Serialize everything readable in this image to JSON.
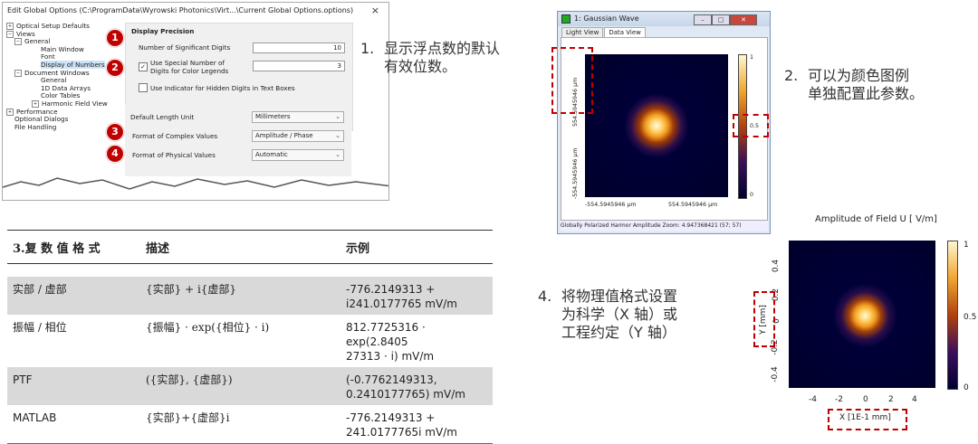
{
  "dialog": {
    "title": "Edit Global Options (C:\\ProgramData\\Wyrowski Photonics\\Virt...\\Current Global Options.options)",
    "close_glyph": "×",
    "tree": {
      "optical_setup": "Optical Setup Defaults",
      "views": "Views",
      "general": "General",
      "main_window": "Main Window",
      "font": "Font",
      "display_numbers": "Display of Numbers",
      "document_windows": "Document Windows",
      "general2": "General",
      "data_arrays": "1D Data Arrays",
      "color_tables": "Color Tables",
      "harmonic": "Harmonic Field View",
      "performance": "Performance",
      "optional_dialogs": "Optional Dialogs",
      "file_handling": "File Handling"
    },
    "section_title": "Display Precision",
    "sig_digits_label": "Number of Significant Digits",
    "sig_digits_value": "10",
    "special_label_1": "Use Special Number of",
    "special_label_2": "Digits for Color Legends",
    "special_checked": "✓",
    "special_value": "3",
    "hidden_label": "Use Indicator for Hidden Digits in Text Boxes",
    "length_label": "Default Length Unit",
    "length_value": "Millimeters",
    "complex_label": "Format of Complex Values",
    "complex_value": "Amplitude / Phase",
    "physical_label": "Format of Physical Values",
    "physical_value": "Automatic",
    "badges": [
      "1",
      "2",
      "3",
      "4"
    ]
  },
  "notes": {
    "n1_num": "1.",
    "n1_line1": "显示浮点数的默认",
    "n1_line2": "有效位数。",
    "n2_num": "2.",
    "n2_line1": "可以为颜色图例",
    "n2_line2": "单独配置此参数。",
    "n4_num": "4.",
    "n4_line1": "将物理值格式设置",
    "n4_line2": "为科学（X 轴）或",
    "n4_line3": "工程约定（Y 轴）"
  },
  "table": {
    "headers": [
      "3.复 数 值 格 式",
      "描述",
      "示例"
    ],
    "rows": [
      {
        "fmt": "实部 / 虚部",
        "desc": "{实部} + i{虚部}",
        "ex1": "-776.2149313 +",
        "ex2": "i241.0177765 mV/m"
      },
      {
        "fmt": "振幅 / 相位",
        "desc": "{振幅} · exp({相位} · i)",
        "ex1": "812.7725316 · exp(2.8405",
        "ex2": "27313 · i) mV/m"
      },
      {
        "fmt": "PTF",
        "desc": "({实部}, {虚部})",
        "ex1": "(-0.7762149313,",
        "ex2": "0.2410177765) mV/m"
      },
      {
        "fmt": "MATLAB",
        "desc": "{实部}+{虚部}i",
        "ex1": "-776.2149313 +",
        "ex2": "241.0177765i mV/m"
      }
    ]
  },
  "gauss_window": {
    "title": "1: Gaussian Wave",
    "tabs": [
      "Light View",
      "Data View"
    ],
    "y_top": "554.5945946 µm",
    "y_bottom": "-554.5945946 µm",
    "x_left": "-554.5945946 µm",
    "x_right": "554.5945946 µm",
    "cbar_top": "1",
    "cbar_mid": "0.5",
    "cbar_bottom": "0",
    "status": "Globally Polarized Harmor  Amplitude   Zoom: 4.947368421    (57; 57)"
  },
  "plot4": {
    "title": "Amplitude of Field U  [ V/m]",
    "xlabel": "X [1E-1 mm]",
    "ylabel": "Y [mm]",
    "xticks": [
      "-4",
      "-2",
      "0",
      "2",
      "4"
    ],
    "yticks": [
      "0.4",
      "0.2",
      "0",
      "-0.2",
      "-0.4"
    ],
    "cbar": [
      "1",
      "0.5",
      "0"
    ]
  },
  "colors": {
    "accent_red": "#c00000",
    "map_dark": "#00002a"
  }
}
